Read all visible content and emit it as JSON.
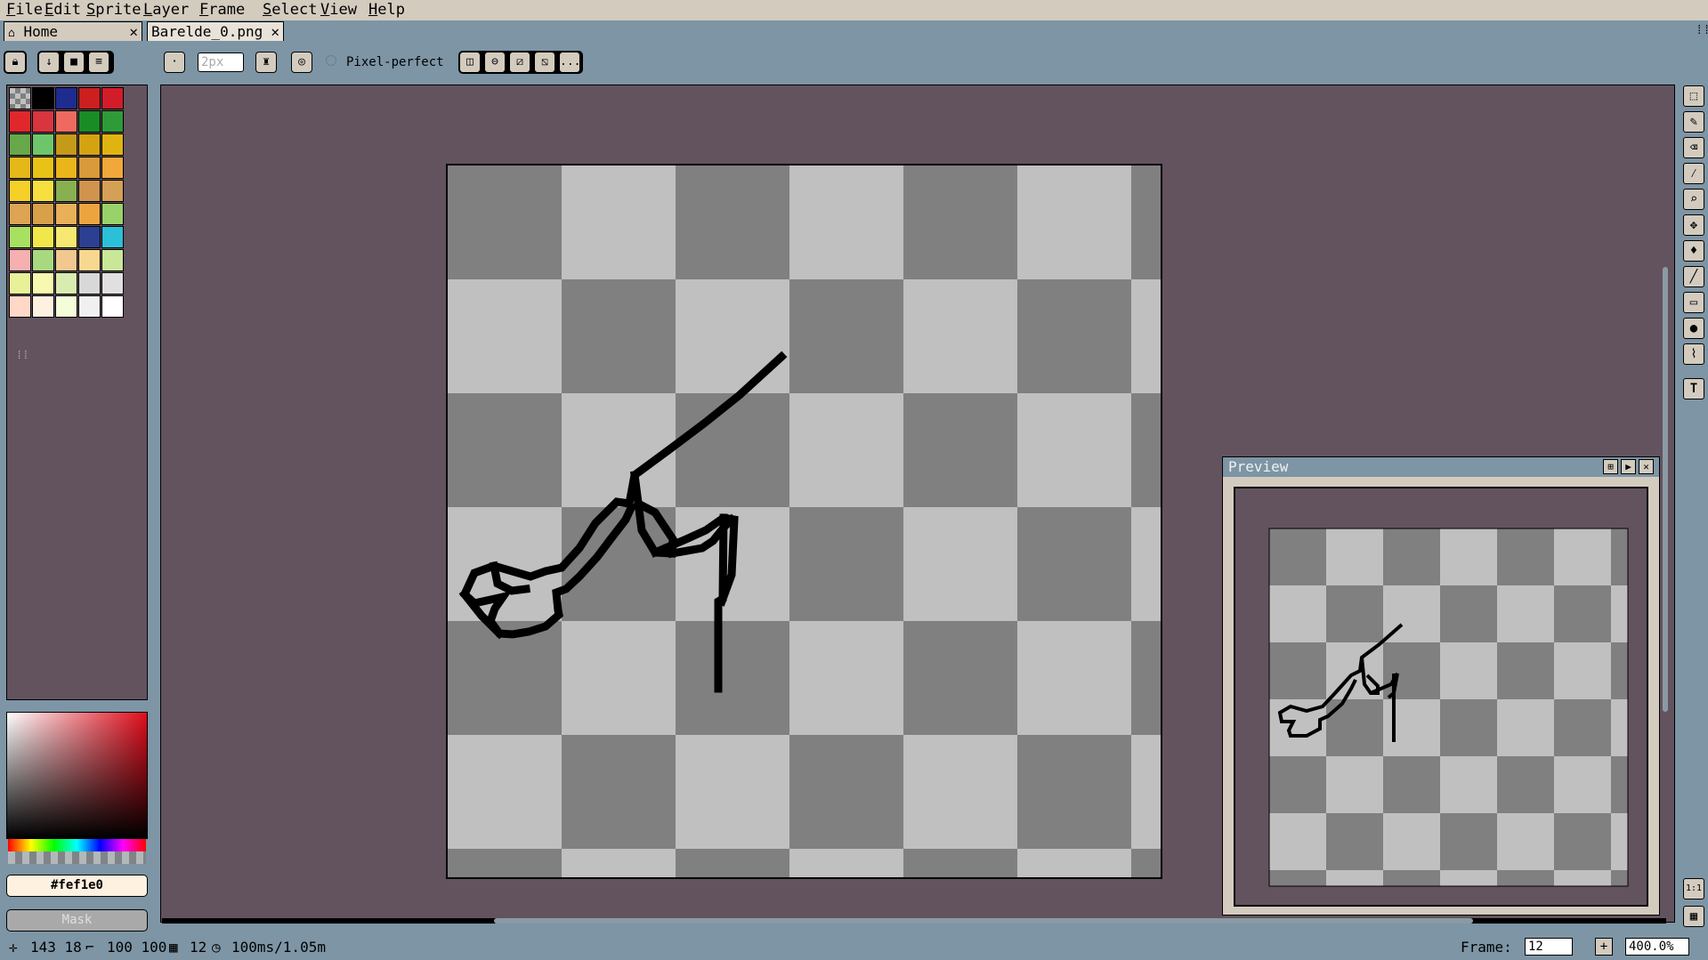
{
  "menu": [
    "File",
    "Edit",
    "Sprite",
    "Layer",
    "Frame",
    "Select",
    "View",
    "Help"
  ],
  "tabs": [
    {
      "label": "Home",
      "close": "✕",
      "active": false
    },
    {
      "label": "Barelde_0.png",
      "close": "✕",
      "active": true
    }
  ],
  "toolbar": {
    "brush_size": "2px",
    "pixel_perfect_label": "Pixel-perfect",
    "more_label": "..."
  },
  "palette": {
    "colors": [
      "#d0d0d0",
      "#000000",
      "#1f2c8f",
      "#cc1f1f",
      "#d21c2a",
      "#e0282c",
      "#d8353f",
      "#ee6a5e",
      "#1a8c26",
      "#2f9b38",
      "#67a84a",
      "#6fc66a",
      "#c59a18",
      "#d3a312",
      "#e0b410",
      "#e4b818",
      "#e8c216",
      "#eab51a",
      "#d89a3a",
      "#f0a83a",
      "#f4d028",
      "#f6e040",
      "#88b050",
      "#d0944e",
      "#d4a055",
      "#dca453",
      "#d8a048",
      "#e8b058",
      "#eca53e",
      "#9ad26a",
      "#a8e060",
      "#f0e84a",
      "#f6e870",
      "#2c3f92",
      "#2cc0d8",
      "#f6b0b0",
      "#a8d880",
      "#f0c890",
      "#f8d890",
      "#c8e898",
      "#e8f098",
      "#f8f8b0",
      "#d8ecb0",
      "#d8d8d8",
      "#e0e0e0",
      "#ffd8c8",
      "#fef1e0",
      "#f4fcd8",
      "#f0f0f0",
      "#ffffff"
    ],
    "grip": "⁞⁞"
  },
  "color": {
    "hex": "#fef1e0",
    "mask_label": "Mask"
  },
  "preview": {
    "title": "Preview"
  },
  "status": {
    "cursor": "143  18",
    "size": "100  100",
    "frames": "12",
    "duration": "100ms/1.05m",
    "frame_label": "Frame:",
    "frame_value": "12",
    "zoom": "400.0%"
  },
  "right_tools": [
    "marquee-tool-icon",
    "pencil-tool-icon",
    "eraser-tool-icon",
    "eyedropper-tool-icon",
    "zoom-tool-icon",
    "move-tool-icon",
    "paint-bucket-tool-icon",
    "line-tool-icon",
    "rectangle-tool-icon",
    "contour-tool-icon",
    "blur-tool-icon",
    "text-tool-icon"
  ],
  "colors": {
    "chrome": "#d3cbbe",
    "background": "#7d95a5",
    "editor_bg": "#63535f",
    "checker_dark": "#808080",
    "checker_light": "#c0c0c0"
  }
}
